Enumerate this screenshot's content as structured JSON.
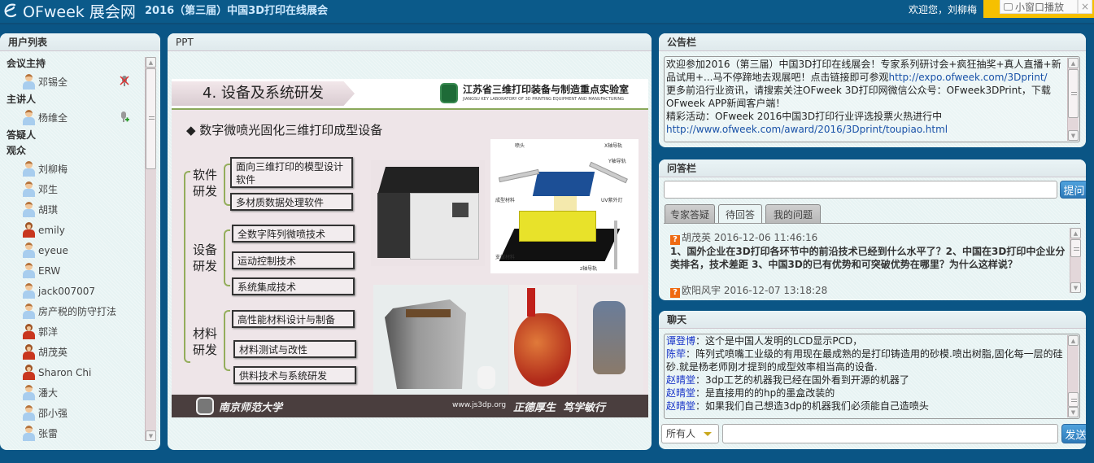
{
  "topbar": {
    "logo_text": "OFweek 展会网",
    "event_title": "2016（第三届）中国3D打印在线展会",
    "welcome": "欢迎您，刘柳梅",
    "mini_window_label": "小窗口播放",
    "close_label": "×"
  },
  "users": {
    "title": "用户列表",
    "groups": {
      "host": "会议主持",
      "speaker": "主讲人",
      "answerer": "答疑人",
      "audience": "观众"
    },
    "host_list": [
      {
        "name": "邓锡全",
        "gender": "m",
        "mic": "muted"
      }
    ],
    "speaker_list": [
      {
        "name": "杨维全",
        "gender": "m",
        "mic": "add"
      }
    ],
    "audience_list": [
      {
        "name": "刘柳梅",
        "gender": "m"
      },
      {
        "name": "邓生",
        "gender": "m"
      },
      {
        "name": "胡琪",
        "gender": "m"
      },
      {
        "name": "emily",
        "gender": "f"
      },
      {
        "name": "eyeue",
        "gender": "m"
      },
      {
        "name": "ERW",
        "gender": "m"
      },
      {
        "name": "jack007007",
        "gender": "m"
      },
      {
        "name": "房产税的防守打法",
        "gender": "m"
      },
      {
        "name": "郭洋",
        "gender": "f"
      },
      {
        "name": "胡茂英",
        "gender": "f"
      },
      {
        "name": "Sharon Chi",
        "gender": "f"
      },
      {
        "name": "潘大",
        "gender": "m"
      },
      {
        "name": "邵小强",
        "gender": "m"
      },
      {
        "name": "张雷",
        "gender": "m"
      }
    ]
  },
  "ppt": {
    "title": "PPT",
    "slide": {
      "section_title": "4. 设备及系统研发",
      "lab_name": "江苏省三维打印装备与制造重点实验室",
      "lab_name_en": "JIANGSU KEY LABORATORY OF 3D PRINTING EQUIPMENT AND MANUFACTURING",
      "bullet": "◆  数字微喷光固化三维打印成型设备",
      "categories": [
        {
          "label": "软件研发",
          "items": [
            "面向三维打印的模型设计软件",
            "多材质数据处理软件"
          ]
        },
        {
          "label": "设备研发",
          "items": [
            "全数字阵列微喷技术",
            "运动控制技术",
            "系统集成技术"
          ]
        },
        {
          "label": "材料研发",
          "items": [
            "高性能材料设计与制备",
            "材料测试与改性",
            "供料技术与系统研发"
          ]
        }
      ],
      "diagram_labels": [
        "喷头",
        "X轴导轨",
        "Y轴导轨",
        "UV紫外灯",
        "成型材料",
        "支撑材料",
        "z轴导轨"
      ],
      "footer_university": "南京师范大学",
      "footer_url": "www.js3dp.org",
      "footer_motto": "正德厚生  笃学敏行"
    }
  },
  "announcement": {
    "title": "公告栏",
    "line1": "欢迎参加2016（第三届）中国3D打印在线展会！专家系列研讨会+疯狂抽奖+真人直播+新品试用+...马不停蹄地去观展吧！点击链接即可参观",
    "link1": "http://expo.ofweek.com/3Dprint/",
    "line2": "更多前沿行业资讯，请搜索关注OFweek 3D打印网微信公众号：OFweek3DPrint，下载OFweek APP新闻客户端！",
    "line3": "精彩活动：OFweek 2016中国3D打印行业评选投票火热进行中",
    "link2": "http://www.ofweek.com/award/2016/3Dprint/toupiao.html"
  },
  "qa": {
    "title": "问答栏",
    "input_value": "",
    "ask_button": "提问",
    "tabs": [
      "专家答疑",
      "待回答",
      "我的问题"
    ],
    "active_tab": "待回答",
    "questions": [
      {
        "user": "胡茂英",
        "time": "2016-12-06 11:46:16",
        "text": "1、国外企业在3D打印各环节中的前沿技术已经到什么水平了？2、中国在3D打印中企业分类排名，技术差距 3、中国3D的已有优势和可突破优势在哪里？为什么这样说？"
      },
      {
        "user": "欧阳风宇",
        "time": "2016-12-07 13:18:28",
        "text": ""
      }
    ]
  },
  "chat": {
    "title": "聊天",
    "messages": [
      {
        "user": "谭登博",
        "text": "这个是中国人发明的LCD显示PCD，"
      },
      {
        "user": "陈荦",
        "text": "阵列式喷嘴工业级的有用现在最成熟的是打印铸造用的砂模.喷出树脂,固化每一层的硅砂.就是杨老师刚才提到的成型效率相当高的设备."
      },
      {
        "user": "赵晴堂",
        "text": "3dp工艺的机器我已经在国外看到开源的机器了"
      },
      {
        "user": "赵晴堂",
        "text": "是直接用的的hp的墨盒改装的"
      },
      {
        "user": "赵晴堂",
        "text": "如果我们自己想造3dp的机器我们必须能自己造喷头"
      }
    ],
    "recipient": "所有人",
    "input_value": "",
    "send_button": "发送"
  }
}
